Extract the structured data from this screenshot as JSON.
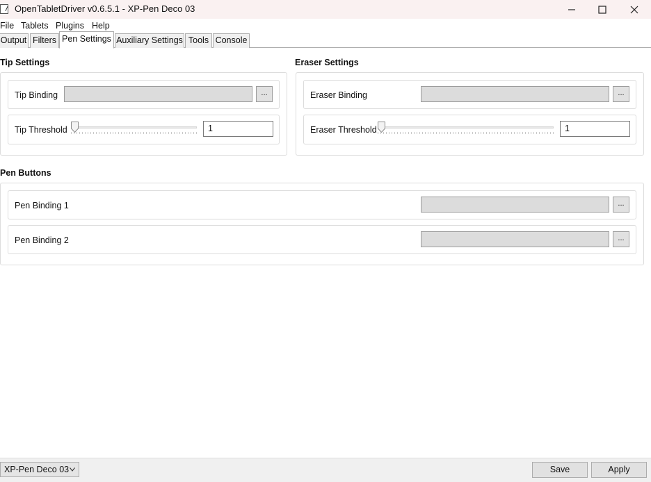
{
  "window": {
    "title": "OpenTabletDriver v0.6.5.1 - XP-Pen Deco 03"
  },
  "menu": {
    "items": [
      "File",
      "Tablets",
      "Plugins",
      "Help"
    ]
  },
  "tabs": {
    "items": [
      "Output",
      "Filters",
      "Pen Settings",
      "Auxiliary Settings",
      "Tools",
      "Console"
    ],
    "active": "Pen Settings"
  },
  "tip": {
    "section_title": "Tip Settings",
    "binding_label": "Tip Binding",
    "binding_value": "",
    "binding_button": "...",
    "threshold_label": "Tip Threshold",
    "threshold_value": "1"
  },
  "eraser": {
    "section_title": "Eraser Settings",
    "binding_label": "Eraser Binding",
    "binding_value": "",
    "binding_button": "...",
    "threshold_label": "Eraser Threshold",
    "threshold_value": "1"
  },
  "pen_buttons": {
    "section_title": "Pen Buttons",
    "bindings": [
      {
        "label": "Pen Binding 1",
        "value": "",
        "button": "..."
      },
      {
        "label": "Pen Binding 2",
        "value": "",
        "button": "..."
      }
    ]
  },
  "footer": {
    "tablet_select": "XP-Pen Deco 03",
    "save_label": "Save",
    "apply_label": "Apply"
  }
}
